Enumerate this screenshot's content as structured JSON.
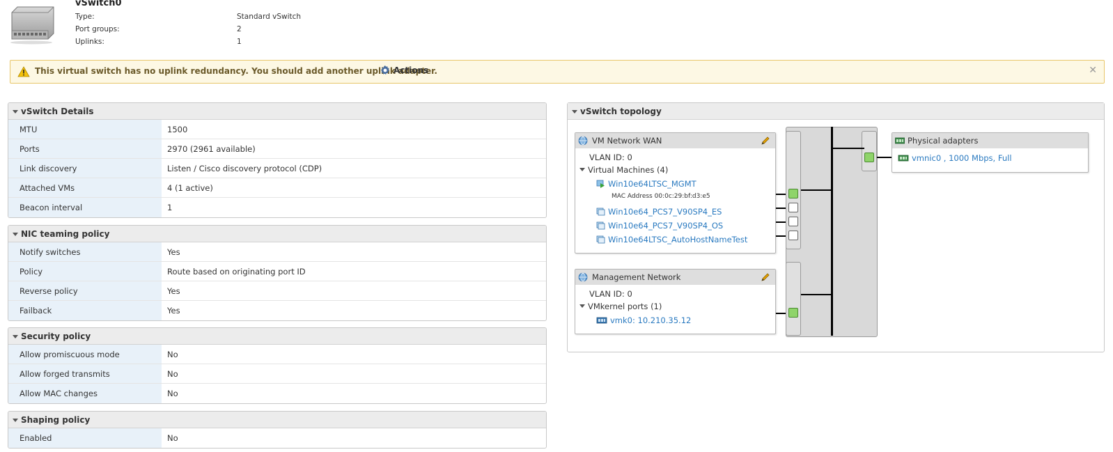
{
  "header": {
    "title": "vSwitch0",
    "rows": [
      {
        "label": "Type:",
        "value": "Standard vSwitch"
      },
      {
        "label": "Port groups:",
        "value": "2"
      },
      {
        "label": "Uplinks:",
        "value": "1"
      }
    ]
  },
  "warning": {
    "text": "This virtual switch has no uplink redundancy. You should add another uplink adapter.",
    "actions_label": "Actions"
  },
  "details": {
    "title": "vSwitch Details",
    "rows": [
      {
        "key": "MTU",
        "value": "1500"
      },
      {
        "key": "Ports",
        "value": "2970 (2961 available)"
      },
      {
        "key": "Link discovery",
        "value": "Listen / Cisco discovery protocol (CDP)"
      },
      {
        "key": "Attached VMs",
        "value": "4 (1 active)"
      },
      {
        "key": "Beacon interval",
        "value": "1"
      }
    ]
  },
  "nic": {
    "title": "NIC teaming policy",
    "rows": [
      {
        "key": "Notify switches",
        "value": "Yes"
      },
      {
        "key": "Policy",
        "value": "Route based on originating port ID"
      },
      {
        "key": "Reverse policy",
        "value": "Yes"
      },
      {
        "key": "Failback",
        "value": "Yes"
      }
    ]
  },
  "security": {
    "title": "Security policy",
    "rows": [
      {
        "key": "Allow promiscuous mode",
        "value": "No"
      },
      {
        "key": "Allow forged transmits",
        "value": "No"
      },
      {
        "key": "Allow MAC changes",
        "value": "No"
      }
    ]
  },
  "shaping": {
    "title": "Shaping policy",
    "rows": [
      {
        "key": "Enabled",
        "value": "No"
      }
    ]
  },
  "topology": {
    "title": "vSwitch topology",
    "wan": {
      "name": "VM Network WAN",
      "vlan": "VLAN ID: 0",
      "vms_label": "Virtual Machines (4)",
      "vms": [
        {
          "name": "Win10e64LTSC_MGMT",
          "mac": "MAC Address 00:0c:29:bf:d3:e5"
        },
        {
          "name": "Win10e64_PCS7_V90SP4_ES"
        },
        {
          "name": "Win10e64_PCS7_V90SP4_OS"
        },
        {
          "name": "Win10e64LTSC_AutoHostNameTest"
        }
      ]
    },
    "mgmt": {
      "name": "Management Network",
      "vlan": "VLAN ID: 0",
      "vmk_label": "VMkernel ports (1)",
      "vmk": "vmk0: 10.210.35.12"
    },
    "physical": {
      "title": "Physical adapters",
      "adapter": "vmnic0 , 1000 Mbps, Full"
    }
  }
}
